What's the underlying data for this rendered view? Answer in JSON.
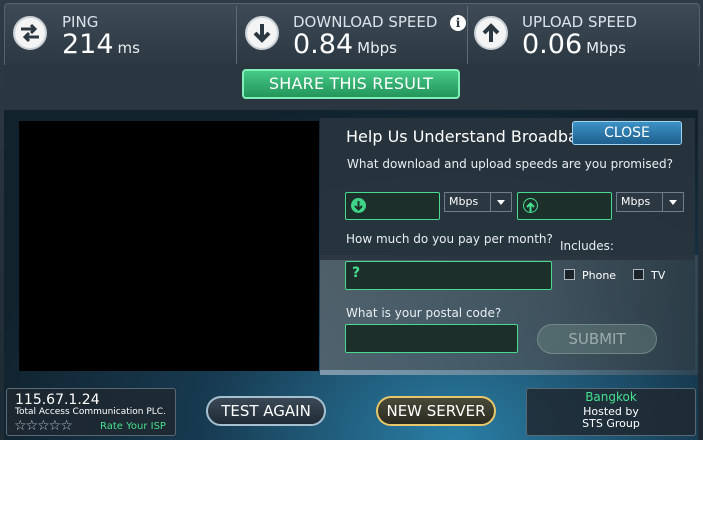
{
  "stats": {
    "ping": {
      "label": "PING",
      "value": "214",
      "unit": "ms"
    },
    "download": {
      "label": "DOWNLOAD SPEED",
      "value": "0.84",
      "unit": "Mbps"
    },
    "upload": {
      "label": "UPLOAD SPEED",
      "value": "0.06",
      "unit": "Mbps"
    }
  },
  "share_label": "SHARE THIS RESULT",
  "survey": {
    "title": "Help Us Understand Broadban",
    "close_label": "CLOSE",
    "q_speeds": "What download and upload speeds are you promised?",
    "download_unit": "Mbps",
    "upload_unit": "Mbps",
    "q_pay": "How much do you pay per month?",
    "pay_placeholder": "?",
    "includes_label": "Includes:",
    "phone_label": "Phone",
    "tv_label": "TV",
    "q_postal": "What is your postal code?",
    "submit_label": "SUBMIT"
  },
  "bottom": {
    "ip": "115.67.1.24",
    "isp": "Total Access Communication PLC.",
    "stars": "☆☆☆☆☆",
    "rate_label": "Rate Your ISP",
    "test_again_label": "TEST AGAIN",
    "new_server_label": "NEW SERVER",
    "city": "Bangkok",
    "hosted_by_label": "Hosted by",
    "host": "STS Group"
  },
  "colors": {
    "accent_green": "#46e08f",
    "panel_bg": "#28343d",
    "close_blue": "#2b7ab0"
  }
}
